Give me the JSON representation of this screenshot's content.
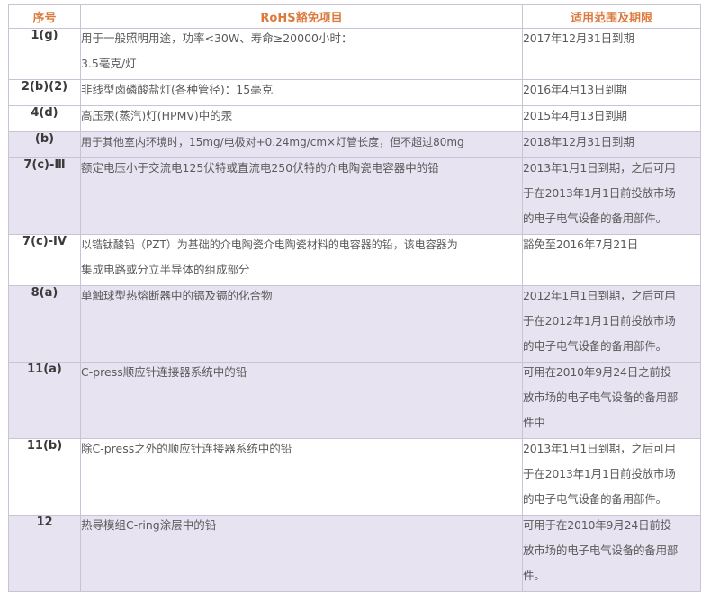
{
  "header": {
    "col_no": "序号",
    "col_item": "RoHS豁免项目",
    "col_scope": "适用范围及期限"
  },
  "rows": [
    {
      "no": "1(g)",
      "item": [
        "用于一般照明用途，功率<30W、寿命≥20000小时：",
        "3.5毫克/灯"
      ],
      "scope": [
        "2017年12月31日到期"
      ]
    },
    {
      "no": "2(b)(2)",
      "item": [
        "非线型卤磷酸盐灯(各种管径)：15毫克"
      ],
      "scope": [
        "2016年4月13日到期"
      ]
    },
    {
      "no": "4(d)",
      "item": [
        "高压汞(蒸汽)灯(HPMV)中的汞"
      ],
      "scope": [
        "2015年4月13日到期"
      ]
    },
    {
      "no": "(b)",
      "item": [
        "用于其他室内环境时，15mg/电极对+0.24mg/cm×灯管长度，但不超过80mg"
      ],
      "scope": [
        "2018年12月31日到期"
      ]
    },
    {
      "no": "7(c)-Ⅲ",
      "item": [
        "额定电压小于交流电125伏特或直流电250伏特的介电陶瓷电容器中的铅"
      ],
      "scope": [
        "2013年1月1日到期，之后可用",
        "于在2013年1月1日前投放市场",
        "的电子电气设备的备用部件。"
      ]
    },
    {
      "no": "7(c)-IV",
      "item": [
        "以锆钛酸铅（PZT）为基础的介电陶瓷介电陶瓷材料的电容器的铅，该电容器为",
        "集成电路或分立半导体的组成部分"
      ],
      "scope": [
        "豁免至2016年7月21日"
      ]
    },
    {
      "no": "8(a)",
      "item": [
        "单触球型热熔断器中的镉及镉的化合物"
      ],
      "scope": [
        "2012年1月1日到期，之后可用",
        "于在2012年1月1日前投放市场",
        "的电子电气设备的备用部件。"
      ]
    },
    {
      "no": "11(a)",
      "item": [
        "C-press顺应针连接器系统中的铅"
      ],
      "scope": [
        "可用在2010年9月24日之前投",
        "放市场的电子电气设备的备用部",
        "件中"
      ]
    },
    {
      "no": "11(b)",
      "item": [
        "除C-press之外的顺应针连接器系统中的铅"
      ],
      "scope": [
        "2013年1月1日到期，之后可用",
        "于在2013年1月1日前投放市场",
        "的电子电气设备的备用部件。"
      ]
    },
    {
      "no": "12",
      "item": [
        "热导模组C-ring涂层中的铅"
      ],
      "scope": [
        "可用于在2010年9月24日前投",
        "放市场的电子电气设备的备用部",
        "件。"
      ]
    }
  ],
  "colors": {
    "header_text": "#dc7a3d",
    "shade": "#e8e3f1",
    "border": "#c9c3d6"
  }
}
